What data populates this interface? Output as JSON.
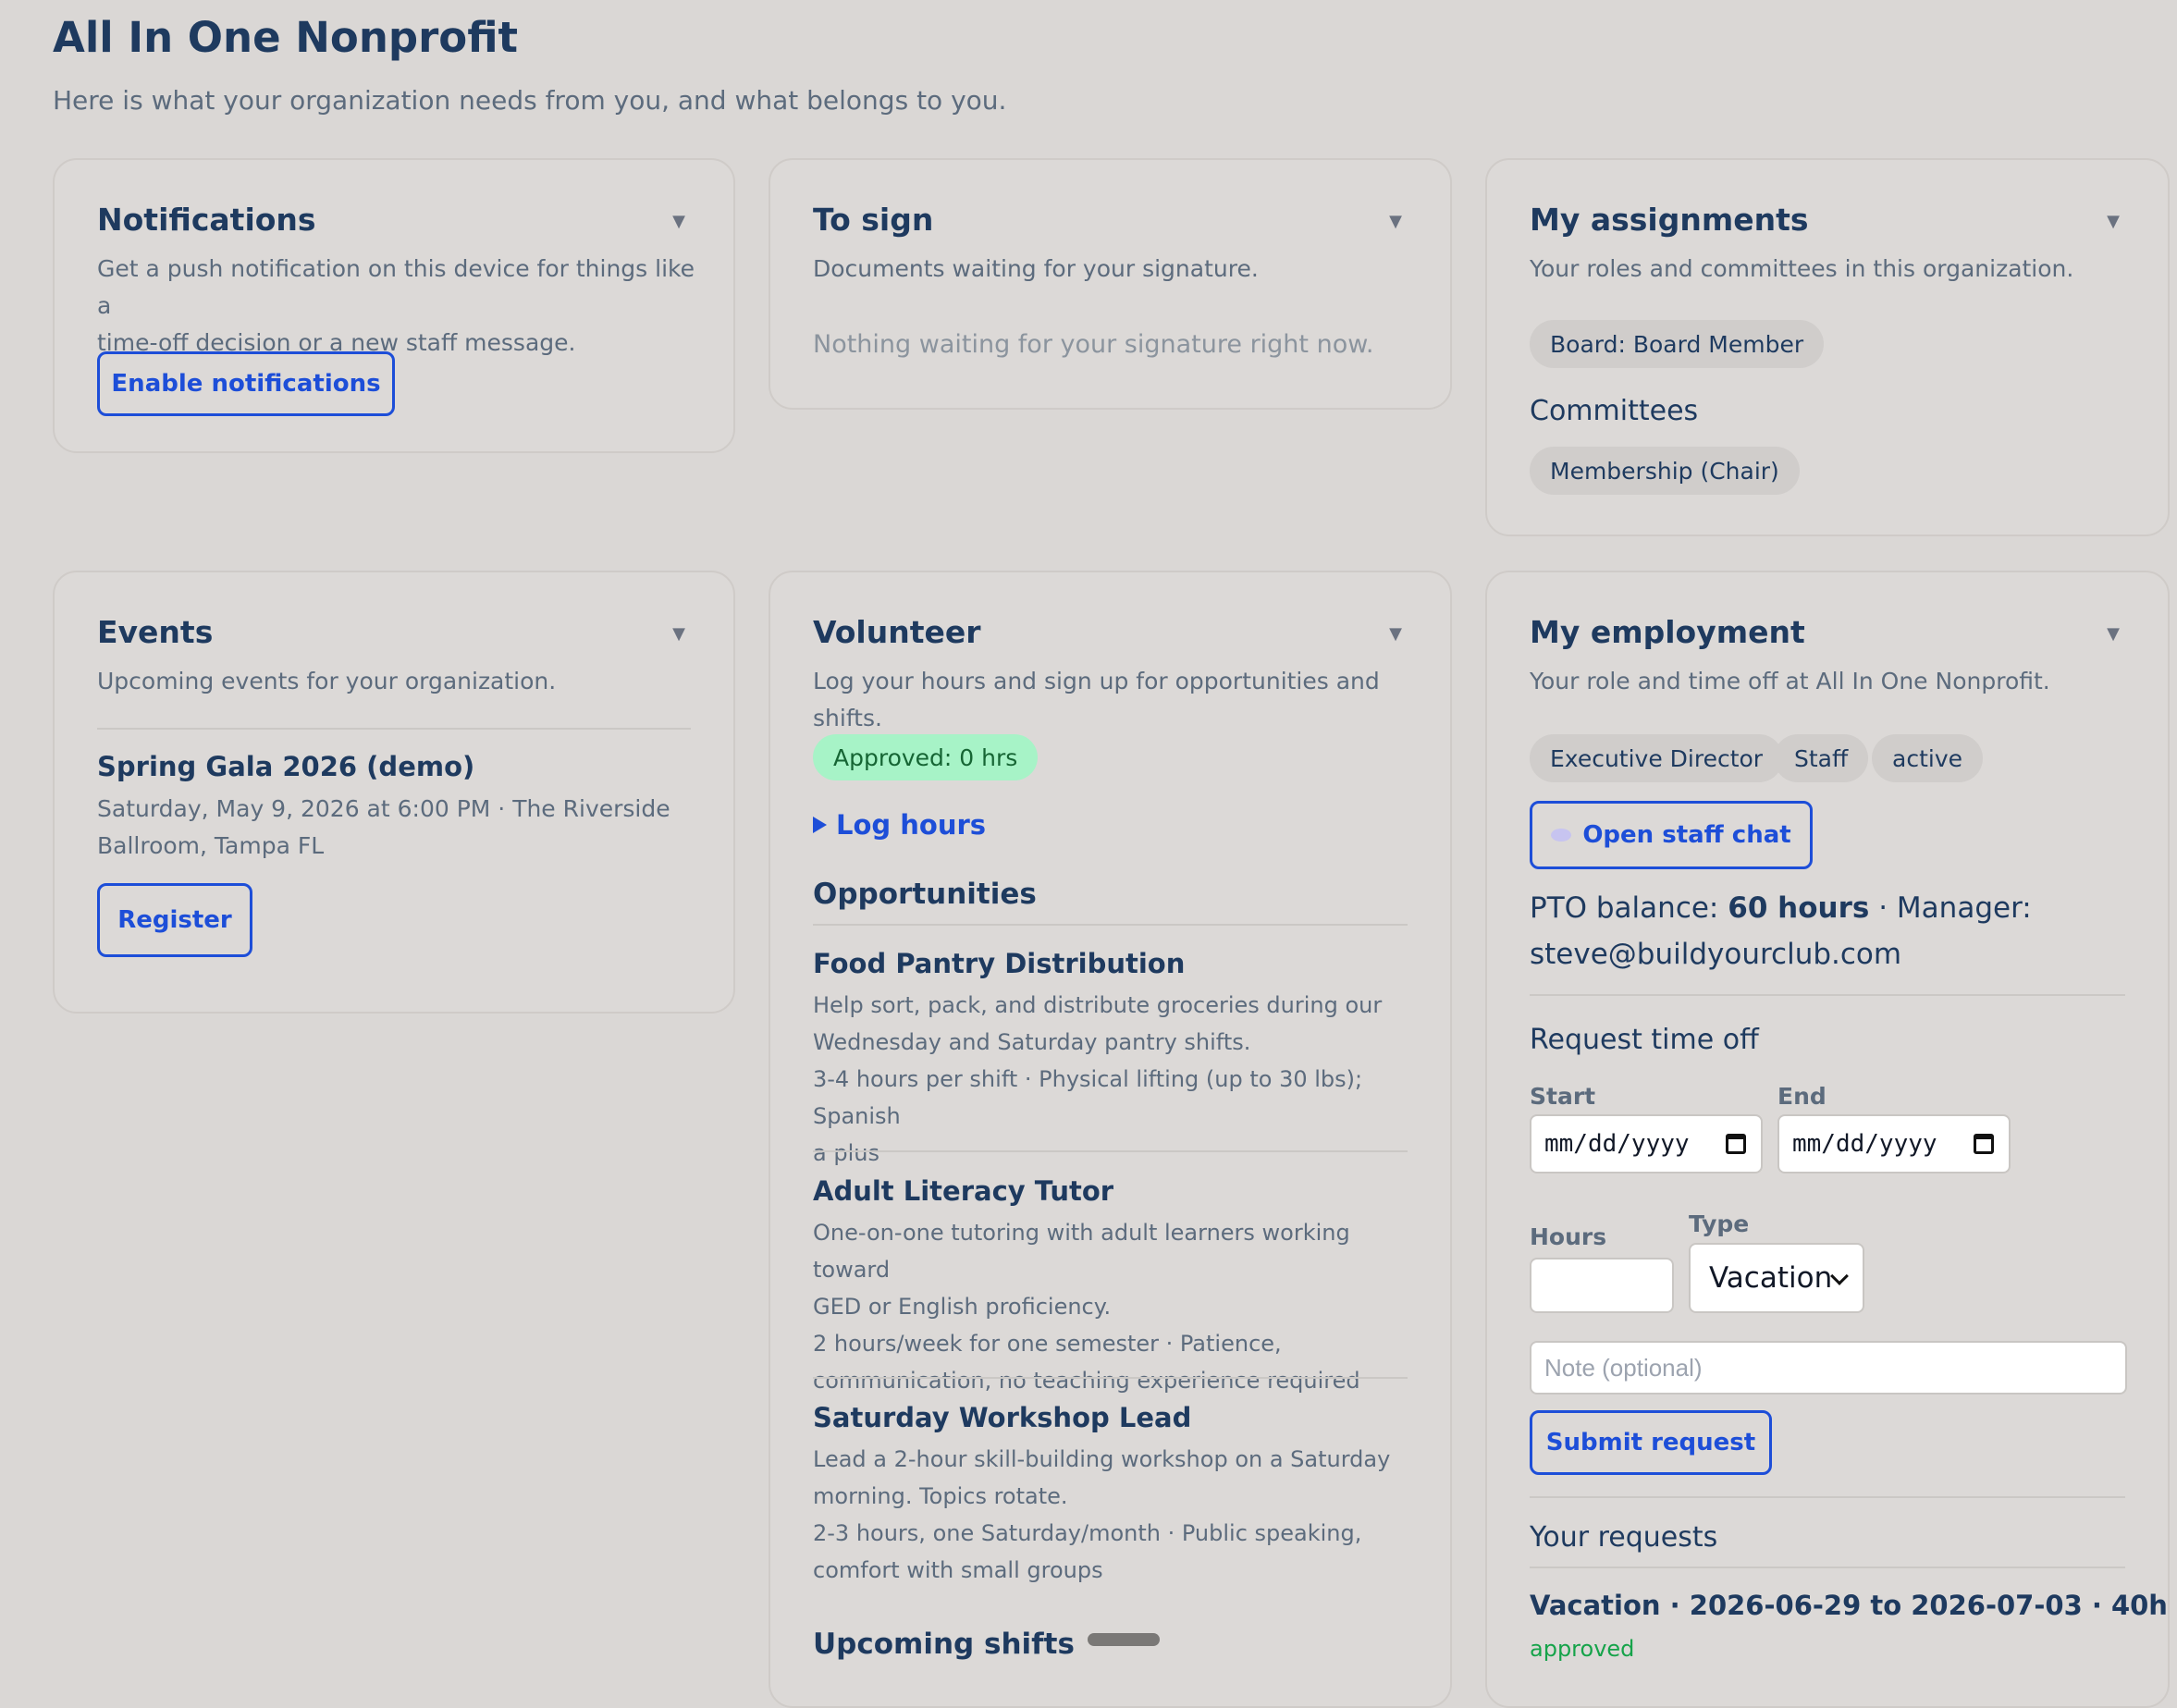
{
  "header": {
    "title": "All In One Nonprofit",
    "subtitle": "Here is what your organization needs from you, and what belongs to you."
  },
  "notifications": {
    "title": "Notifications",
    "desc_line1": "Get a push notification on this device for things like a",
    "desc_line2": "time-off decision or a new staff message.",
    "button": "Enable notifications"
  },
  "to_sign": {
    "title": "To sign",
    "desc": "Documents waiting for your signature.",
    "empty": "Nothing waiting for your signature right now."
  },
  "assignments": {
    "title": "My assignments",
    "desc": "Your roles and committees in this organization.",
    "role_chip": "Board: Board Member",
    "committees_heading": "Committees",
    "committee_chip": "Membership (Chair)"
  },
  "events": {
    "title": "Events",
    "desc": "Upcoming events for your organization.",
    "event_title": "Spring Gala 2026 (demo)",
    "event_line1": "Saturday, May 9, 2026 at 6:00 PM · The Riverside",
    "event_line2": "Ballroom, Tampa FL",
    "register": "Register"
  },
  "volunteer": {
    "title": "Volunteer",
    "desc": "Log your hours and sign up for opportunities and shifts.",
    "approved": "Approved: 0 hrs",
    "log_hours": "Log hours",
    "opportunities_heading": "Opportunities",
    "opportunities": [
      {
        "title": "Food Pantry Distribution",
        "line1": "Help sort, pack, and distribute groceries during our",
        "line2": "Wednesday and Saturday pantry shifts.",
        "line3": "3-4 hours per shift · Physical lifting (up to 30 lbs); Spanish",
        "line4": "a plus"
      },
      {
        "title": "Adult Literacy Tutor",
        "line1": "One-on-one tutoring with adult learners working toward",
        "line2": "GED or English proficiency.",
        "line3": "2 hours/week for one semester · Patience,",
        "line4": "communication, no teaching experience required"
      },
      {
        "title": "Saturday Workshop Lead",
        "line1": "Lead a 2-hour skill-building workshop on a Saturday",
        "line2": "morning. Topics rotate.",
        "line3": "2-3 hours, one Saturday/month · Public speaking,",
        "line4": "comfort with small groups"
      }
    ],
    "shifts_heading": "Upcoming shifts"
  },
  "employment": {
    "title": "My employment",
    "desc": "Your role and time off at All In One Nonprofit.",
    "chips": [
      "Executive Director",
      "Staff",
      "active"
    ],
    "chat_button": "Open staff chat",
    "pto_label": "PTO balance:",
    "pto_value": "60 hours",
    "manager_label": "· Manager:",
    "manager_email": "steve@buildyourclub.com",
    "request_heading": "Request time off",
    "start_label": "Start",
    "end_label": "End",
    "date_placeholder": "mm/dd/yyyy",
    "hours_label": "Hours",
    "type_label": "Type",
    "type_value": "Vacation",
    "note_placeholder": "Note (optional)",
    "submit": "Submit request",
    "requests_heading": "Your requests",
    "request_item": "Vacation · 2026-06-29 to 2026-07-03 · 40h",
    "request_status": "approved"
  },
  "colors": {
    "accent": "#1d4ed8",
    "heading": "#1e3a5f",
    "approved_bg": "#a7f3c7",
    "approved_text": "#16a34a"
  }
}
